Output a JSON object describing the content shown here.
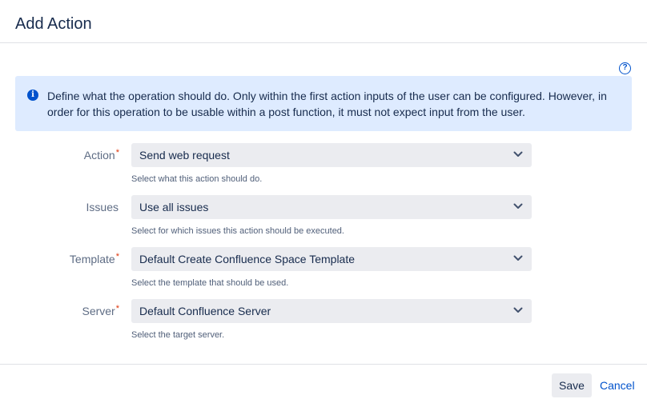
{
  "dialog": {
    "title": "Add Action"
  },
  "help": {
    "icon": "question-circle-icon",
    "glyph": "?"
  },
  "info": {
    "icon": "info-circle-icon",
    "glyph": "i",
    "text": "Define what the operation should do. Only within the first action inputs of the user can be configured. However, in order for this operation to be usable within a post function, it must not expect input from the user."
  },
  "fields": [
    {
      "label": "Action",
      "required": true,
      "required_mark": "*",
      "value": "Send web request",
      "description": "Select what this action should do."
    },
    {
      "label": "Issues",
      "required": false,
      "required_mark": "",
      "value": "Use all issues",
      "description": "Select for which issues this action should be executed."
    },
    {
      "label": "Template",
      "required": true,
      "required_mark": "*",
      "value": "Default Create Confluence Space Template",
      "description": "Select the template that should be used."
    },
    {
      "label": "Server",
      "required": true,
      "required_mark": "*",
      "value": "Default Confluence Server",
      "description": "Select the target server."
    }
  ],
  "footer": {
    "save_label": "Save",
    "cancel_label": "Cancel"
  },
  "colors": {
    "info_background": "#deebff",
    "accent": "#0052cc",
    "required": "#de350b",
    "select_background": "#ebecf0"
  }
}
